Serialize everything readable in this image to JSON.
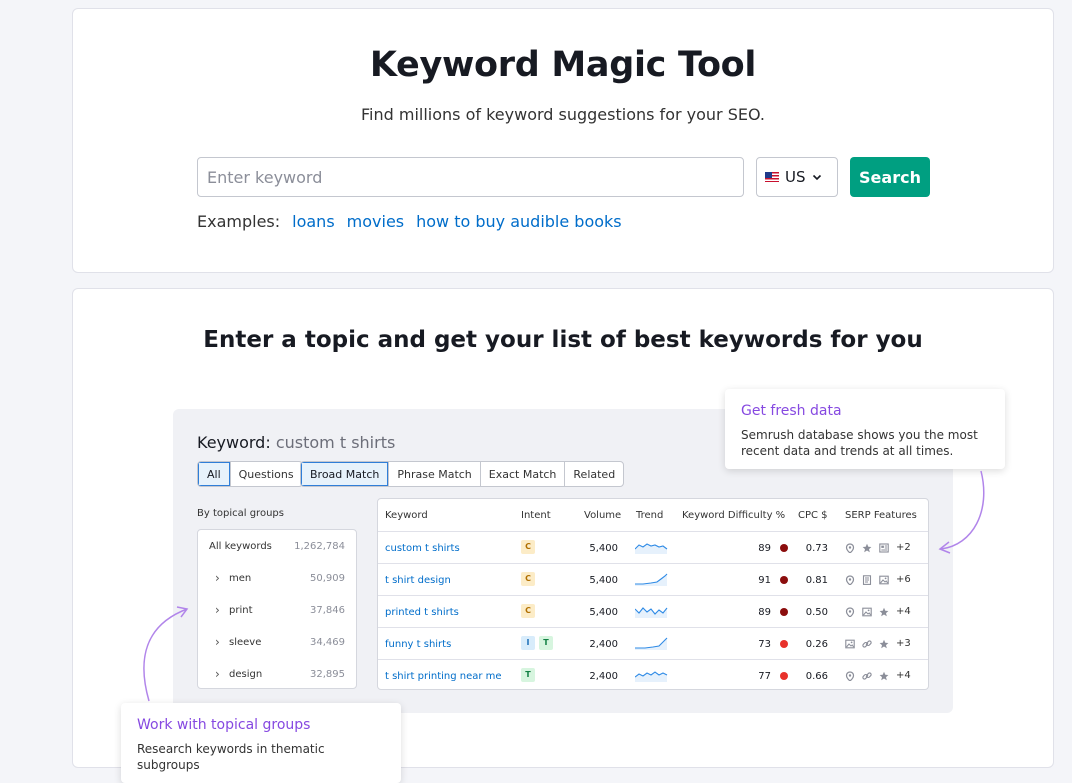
{
  "hero": {
    "title": "Keyword Magic Tool",
    "subtitle": "Find millions of keyword suggestions for your SEO.",
    "keyword_placeholder": "Enter keyword",
    "keyword_value": "",
    "country": "US",
    "search_label": "Search",
    "examples_label": "Examples:",
    "examples": [
      "loans",
      "movies",
      "how to buy audible books"
    ]
  },
  "promo": {
    "title": "Enter a topic and get your list of best keywords for you",
    "demo": {
      "keyword_label": "Keyword:",
      "keyword_value": "custom t shirts",
      "filter_tabs": [
        "All",
        "Questions"
      ],
      "match_tabs": [
        "Broad Match",
        "Phrase Match",
        "Exact Match",
        "Related"
      ],
      "groups_title": "By topical groups",
      "groups": [
        {
          "label": "All keywords",
          "count": "1,262,784"
        },
        {
          "label": "men",
          "count": "50,909"
        },
        {
          "label": "print",
          "count": "37,846"
        },
        {
          "label": "sleeve",
          "count": "34,469"
        },
        {
          "label": "design",
          "count": "32,895"
        }
      ],
      "table_headers": [
        "Keyword",
        "Intent",
        "Volume",
        "Trend",
        "Keyword Difficulty %",
        "CPC $",
        "SERP Features"
      ],
      "rows": [
        {
          "keyword": "custom t shirts",
          "intent": [
            "C"
          ],
          "volume": "5,400",
          "kd": "89",
          "kd_color": "#8b0d0d",
          "cpc": "0.73",
          "serp_icons": [
            "pin-icon",
            "star-icon",
            "news-icon"
          ],
          "serp_more": "+2"
        },
        {
          "keyword": "t shirt design",
          "intent": [
            "C"
          ],
          "volume": "5,400",
          "kd": "91",
          "kd_color": "#8b0d0d",
          "cpc": "0.81",
          "serp_icons": [
            "pin-icon",
            "doc-icon",
            "image-icon"
          ],
          "serp_more": "+6"
        },
        {
          "keyword": "printed t shirts",
          "intent": [
            "C"
          ],
          "volume": "5,400",
          "kd": "89",
          "kd_color": "#8b0d0d",
          "cpc": "0.50",
          "serp_icons": [
            "pin-icon",
            "image-icon",
            "star-icon"
          ],
          "serp_more": "+4"
        },
        {
          "keyword": "funny t shirts",
          "intent": [
            "I",
            "T"
          ],
          "volume": "2,400",
          "kd": "73",
          "kd_color": "#e8322b",
          "cpc": "0.26",
          "serp_icons": [
            "image-icon",
            "link-icon",
            "star-icon"
          ],
          "serp_more": "+3"
        },
        {
          "keyword": "t shirt printing near me",
          "intent": [
            "T"
          ],
          "volume": "2,400",
          "kd": "77",
          "kd_color": "#e8322b",
          "cpc": "0.66",
          "serp_icons": [
            "pin-icon",
            "link-icon",
            "star-icon"
          ],
          "serp_more": "+4"
        }
      ]
    },
    "callout_fresh": {
      "title": "Get fresh data",
      "desc": "Semrush database shows you the most recent data and trends at all times."
    },
    "callout_groups": {
      "title": "Work with topical groups",
      "desc": "Research keywords in thematic subgroups"
    }
  },
  "colors": {
    "accent": "#009f81",
    "link": "#006dca",
    "callout_title": "#8649e1"
  }
}
